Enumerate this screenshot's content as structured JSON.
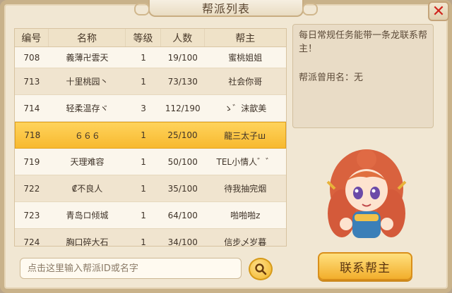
{
  "window": {
    "title": "帮派列表",
    "close_label": "✕"
  },
  "table": {
    "headers": [
      "编号",
      "名称",
      "等级",
      "人数",
      "帮主"
    ],
    "rows": [
      {
        "id": "708",
        "name": "義薄卍雲天",
        "level": "1",
        "members": "19/100",
        "leader": "蜜桃姐姐"
      },
      {
        "id": "713",
        "name": "十里桃园丶",
        "level": "1",
        "members": "73/130",
        "leader": "社会你哥"
      },
      {
        "id": "714",
        "name": "轻柔温存ヾ",
        "level": "3",
        "members": "112/190",
        "leader": "ゝ゛沫歆美"
      },
      {
        "id": "718",
        "name": "６６６",
        "level": "1",
        "members": "25/100",
        "leader": "龍三太子ш"
      },
      {
        "id": "719",
        "name": "天理难容",
        "level": "1",
        "members": "50/100",
        "leader": "TEL小情人゛゛"
      },
      {
        "id": "722",
        "name": "₡不良人",
        "level": "1",
        "members": "35/100",
        "leader": "待我抽完烟"
      },
      {
        "id": "723",
        "name": "青岛ロ倾城",
        "level": "1",
        "members": "64/100",
        "leader": "啪啪啪z"
      },
      {
        "id": "724",
        "name": "胸口碎大石",
        "level": "1",
        "members": "34/100",
        "leader": "信步乄岁暮"
      }
    ],
    "selected_id": "718"
  },
  "info": {
    "daily_task_text": "每日常规任务能带一条龙联系帮主！",
    "alias_label": "帮派曾用名：无"
  },
  "search": {
    "placeholder": "点击这里输入帮派ID或名字",
    "icon": "search-icon"
  },
  "contact_button": "联系帮主",
  "colors": {
    "selected_row": "#f7b92f",
    "close_x": "#d0241c"
  }
}
